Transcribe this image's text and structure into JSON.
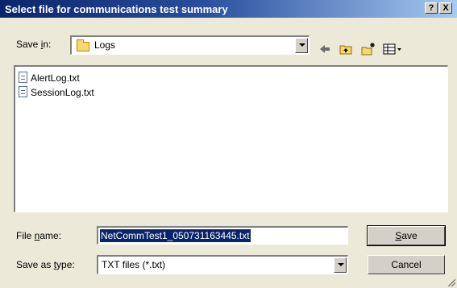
{
  "window": {
    "title": "Select file for communications test summary",
    "help_label": "?",
    "close_label": "X"
  },
  "save_in": {
    "label_pre": "Save ",
    "label_u": "i",
    "label_post": "n:",
    "value": "Logs",
    "icon": "folder-icon"
  },
  "toolbar": {
    "icons": [
      "back-arrow-icon",
      "up-folder-icon",
      "new-folder-icon",
      "view-menu-icon"
    ]
  },
  "files": [
    {
      "name": "AlertLog.txt",
      "icon": "text-document-icon"
    },
    {
      "name": "SessionLog.txt",
      "icon": "text-document-icon"
    }
  ],
  "file_name": {
    "label_pre": "File ",
    "label_u": "n",
    "label_post": "ame:",
    "value": "NetCommTest1_050731163445.txt"
  },
  "save_as_type": {
    "label_pre": "Save as ",
    "label_u": "t",
    "label_post": "ype:",
    "value": "TXT files (*.txt)"
  },
  "buttons": {
    "save_u": "S",
    "save_rest": "ave",
    "cancel": "Cancel"
  },
  "colors": {
    "title_start": "#0a246a",
    "title_end": "#a6caf0",
    "face": "#ece9d8",
    "selection": "#0a246a"
  }
}
